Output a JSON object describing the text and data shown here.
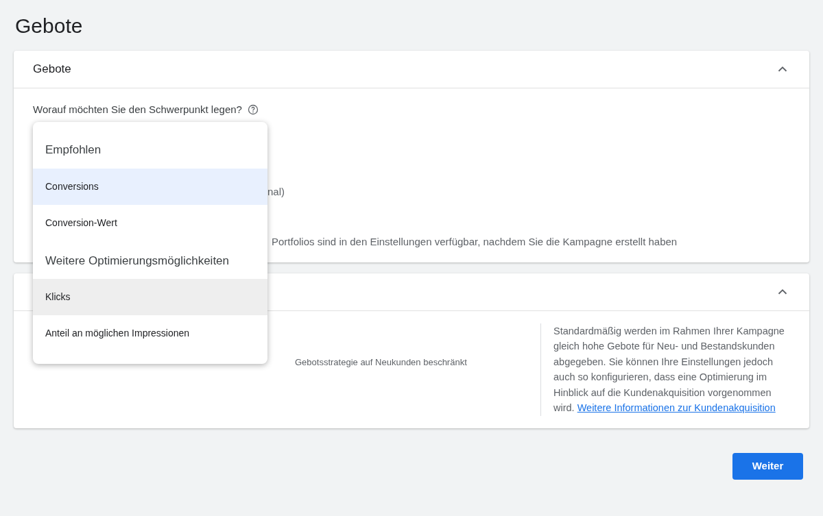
{
  "page_title": "Gebote",
  "bidding_card": {
    "title": "Gebote",
    "expanded": true,
    "question": "Worauf möchten Sie den Schwerpunkt legen?",
    "hidden_option_tail": "nal)",
    "portfolio_note": "Portfolios sind in den Einstellungen verfügbar, nachdem Sie die Kampagne erstellt haben"
  },
  "customer_card": {
    "expanded": true,
    "note_tail": "Gebotsstrategie auf Neukunden beschränkt",
    "info": "Standardmäßig werden im Rahmen Ihrer Kampagne gleich hohe Gebote für Neu- und Bestandskunden abgegeben. Sie können Ihre Einstellungen jedoch auch so konfigurieren, dass eine Optimierung im Hinblick auf die Kundenakquisition vorgenommen wird.",
    "link": "Weitere Informationen zur Kundenakquisition"
  },
  "dropdown_menu": [
    {
      "kind": "header",
      "label": "Empfohlen"
    },
    {
      "kind": "option",
      "label": "Conversions",
      "selected": true,
      "hovered": false
    },
    {
      "kind": "option",
      "label": "Conversion-Wert",
      "selected": false,
      "hovered": false
    },
    {
      "kind": "header",
      "label": "Weitere Optimierungsmöglichkeiten"
    },
    {
      "kind": "option",
      "label": "Klicks",
      "selected": false,
      "hovered": true
    },
    {
      "kind": "option",
      "label": "Anteil an möglichen Impressionen",
      "selected": false,
      "hovered": false
    }
  ],
  "next_button": "Weiter"
}
